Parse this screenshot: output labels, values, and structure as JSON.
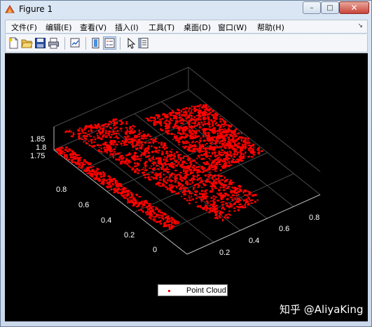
{
  "window": {
    "title": "Figure 1",
    "controls": {
      "minimize": "–",
      "maximize": "□",
      "close": "✕"
    }
  },
  "menubar": {
    "items": [
      {
        "label": "文件(F)"
      },
      {
        "label": "编辑(E)"
      },
      {
        "label": "查看(V)"
      },
      {
        "label": "插入(I)"
      },
      {
        "label": "工具(T)"
      },
      {
        "label": "桌面(D)"
      },
      {
        "label": "窗口(W)"
      },
      {
        "label": "帮助(H)"
      }
    ],
    "overflow_icon": "menu-arrow-icon",
    "overflow_glyph": "↘"
  },
  "toolbar": {
    "buttons": [
      {
        "name": "new-figure",
        "icon": "new-file-icon"
      },
      {
        "name": "open-file",
        "icon": "open-folder-icon"
      },
      {
        "name": "save-figure",
        "icon": "save-disk-icon"
      },
      {
        "name": "print-figure",
        "icon": "printer-icon"
      },
      {
        "name": "link-plot",
        "icon": "link-plot-icon"
      },
      {
        "name": "colorbar",
        "icon": "colorbar-icon"
      },
      {
        "name": "legend",
        "icon": "legend-icon"
      },
      {
        "name": "edit-plot",
        "icon": "pointer-arrow-icon"
      },
      {
        "name": "property-inspector",
        "icon": "property-inspector-icon"
      }
    ]
  },
  "chart_data": {
    "type": "scatter",
    "projection": "3d",
    "background": "#000000",
    "point_color": "#ff0000",
    "grid": true,
    "series": [
      {
        "name": "Point Cloud"
      }
    ],
    "z_ticks": [
      "1.85",
      "1.8",
      "1.75"
    ],
    "y_ticks": [
      "0.8",
      "0.6",
      "0.4",
      "0.2",
      "0"
    ],
    "x_ticks": [
      "0.2",
      "0.4",
      "0.6",
      "0.8"
    ],
    "zlim": [
      1.7,
      1.9
    ],
    "ylim": [
      0,
      1
    ],
    "xlim": [
      0,
      1
    ],
    "legend_position": "bottom"
  },
  "watermark": {
    "text": "知乎 @AliyaKing"
  }
}
